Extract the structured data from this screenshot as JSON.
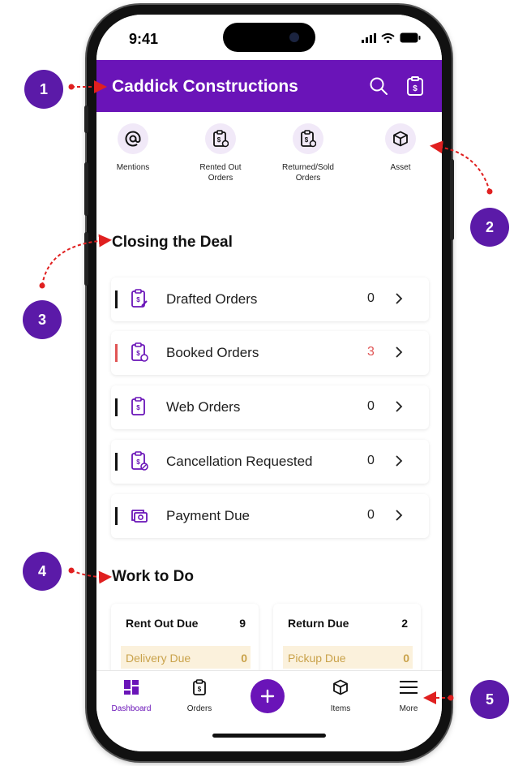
{
  "status_bar": {
    "time": "9:41",
    "icons": [
      "signal-icon",
      "wifi-icon",
      "battery-icon"
    ]
  },
  "header": {
    "title": "Caddick Constructions",
    "icons": [
      "search-icon",
      "clipboard-dollar-icon"
    ],
    "background": "#6a14b8"
  },
  "quick_actions": [
    {
      "label": "Mentions",
      "icon": "at-sign-icon"
    },
    {
      "label": "Rented Out\nOrders",
      "icon": "clipboard-dollar-icon"
    },
    {
      "label": "Returned/Sold\nOrders",
      "icon": "clipboard-dollar-icon"
    },
    {
      "label": "Asset",
      "icon": "box-icon"
    }
  ],
  "closing_section": {
    "title": "Closing the Deal",
    "rows": [
      {
        "label": "Drafted Orders",
        "count": "0",
        "highlight": false,
        "icon": "clipboard-edit-icon"
      },
      {
        "label": "Booked Orders",
        "count": "3",
        "highlight": true,
        "icon": "clipboard-clock-icon"
      },
      {
        "label": "Web Orders",
        "count": "0",
        "highlight": false,
        "icon": "clipboard-dollar-icon"
      },
      {
        "label": "Cancellation Requested",
        "count": "0",
        "highlight": false,
        "icon": "clipboard-cancel-icon"
      },
      {
        "label": "Payment Due",
        "count": "0",
        "highlight": false,
        "icon": "cash-icon"
      }
    ]
  },
  "work_section": {
    "title": "Work to Do",
    "cards": [
      {
        "title": "Rent Out Due",
        "value": "9",
        "sub_label": "Delivery Due",
        "sub_value": "0"
      },
      {
        "title": "Return Due",
        "value": "2",
        "sub_label": "Pickup Due",
        "sub_value": "0"
      }
    ]
  },
  "bottom_nav": {
    "items": [
      {
        "label": "Dashboard",
        "icon": "dashboard-icon",
        "active": true
      },
      {
        "label": "Orders",
        "icon": "clipboard-dollar-icon",
        "active": false
      },
      {
        "label": "Items",
        "icon": "box-icon",
        "active": false
      },
      {
        "label": "More",
        "icon": "menu-icon",
        "active": false
      }
    ],
    "fab_icon": "plus-icon"
  },
  "annotations": [
    "1",
    "2",
    "3",
    "4",
    "5"
  ],
  "colors": {
    "accent": "#6a14b8",
    "badge": "#5b1aa8",
    "alert": "#e05555",
    "due": "#c9a24a",
    "arrow": "#e02020"
  }
}
